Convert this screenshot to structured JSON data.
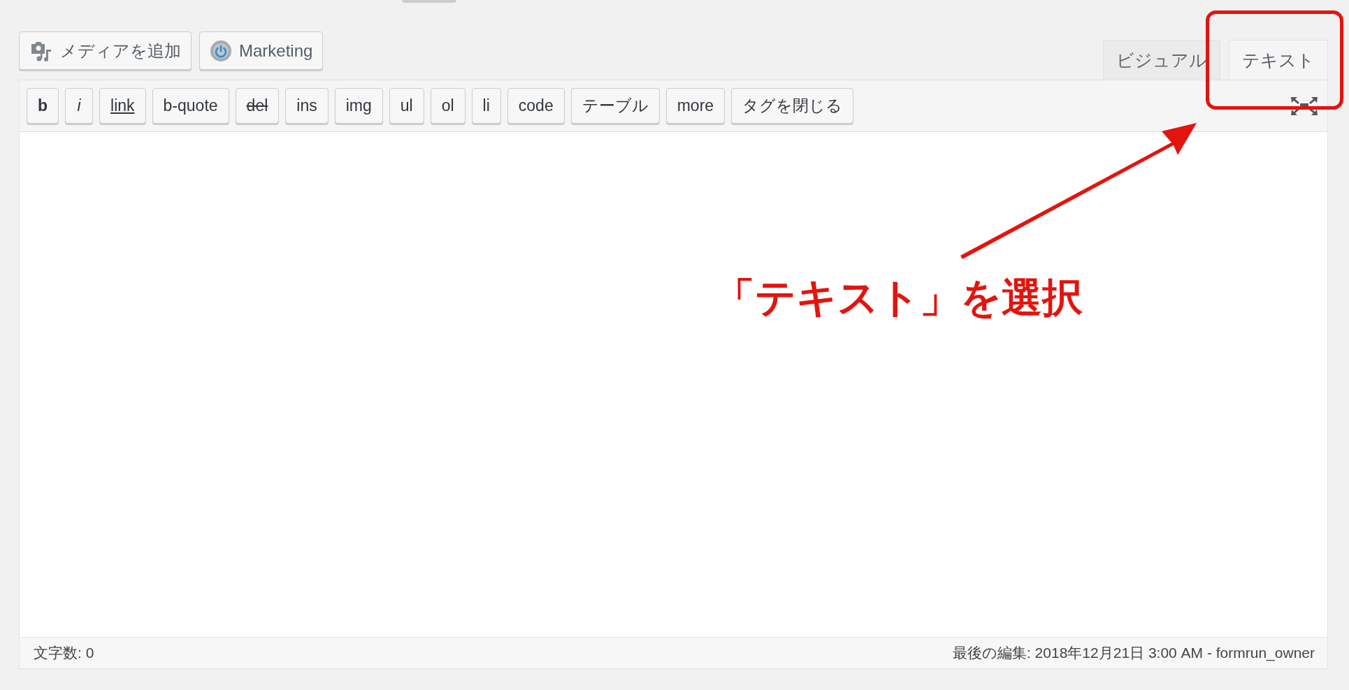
{
  "media_buttons": [
    {
      "kind": "media",
      "label": "メディアを追加"
    },
    {
      "kind": "plugin",
      "label": "Marketing"
    }
  ],
  "editor_tabs": [
    {
      "label": "ビジュアル",
      "selected": false
    },
    {
      "label": "テキスト",
      "selected": true
    }
  ],
  "quicktags": [
    {
      "label": "b",
      "kind": "bold"
    },
    {
      "label": "i",
      "kind": "italic"
    },
    {
      "label": "link",
      "kind": "underline"
    },
    {
      "label": "b-quote",
      "kind": "plain"
    },
    {
      "label": "del",
      "kind": "strike"
    },
    {
      "label": "ins",
      "kind": "plain"
    },
    {
      "label": "img",
      "kind": "plain"
    },
    {
      "label": "ul",
      "kind": "plain"
    },
    {
      "label": "ol",
      "kind": "plain"
    },
    {
      "label": "li",
      "kind": "plain"
    },
    {
      "label": "code",
      "kind": "plain"
    },
    {
      "label": "テーブル",
      "kind": "plain"
    },
    {
      "label": "more",
      "kind": "plain"
    },
    {
      "label": "タグを閉じる",
      "kind": "plain"
    }
  ],
  "status_bar": {
    "word_count": "文字数: 0",
    "last_edited": "最後の編集: 2018年12月21日 3:00 AM - formrun_owner"
  },
  "annotation": {
    "text": "「テキスト」を選択"
  }
}
